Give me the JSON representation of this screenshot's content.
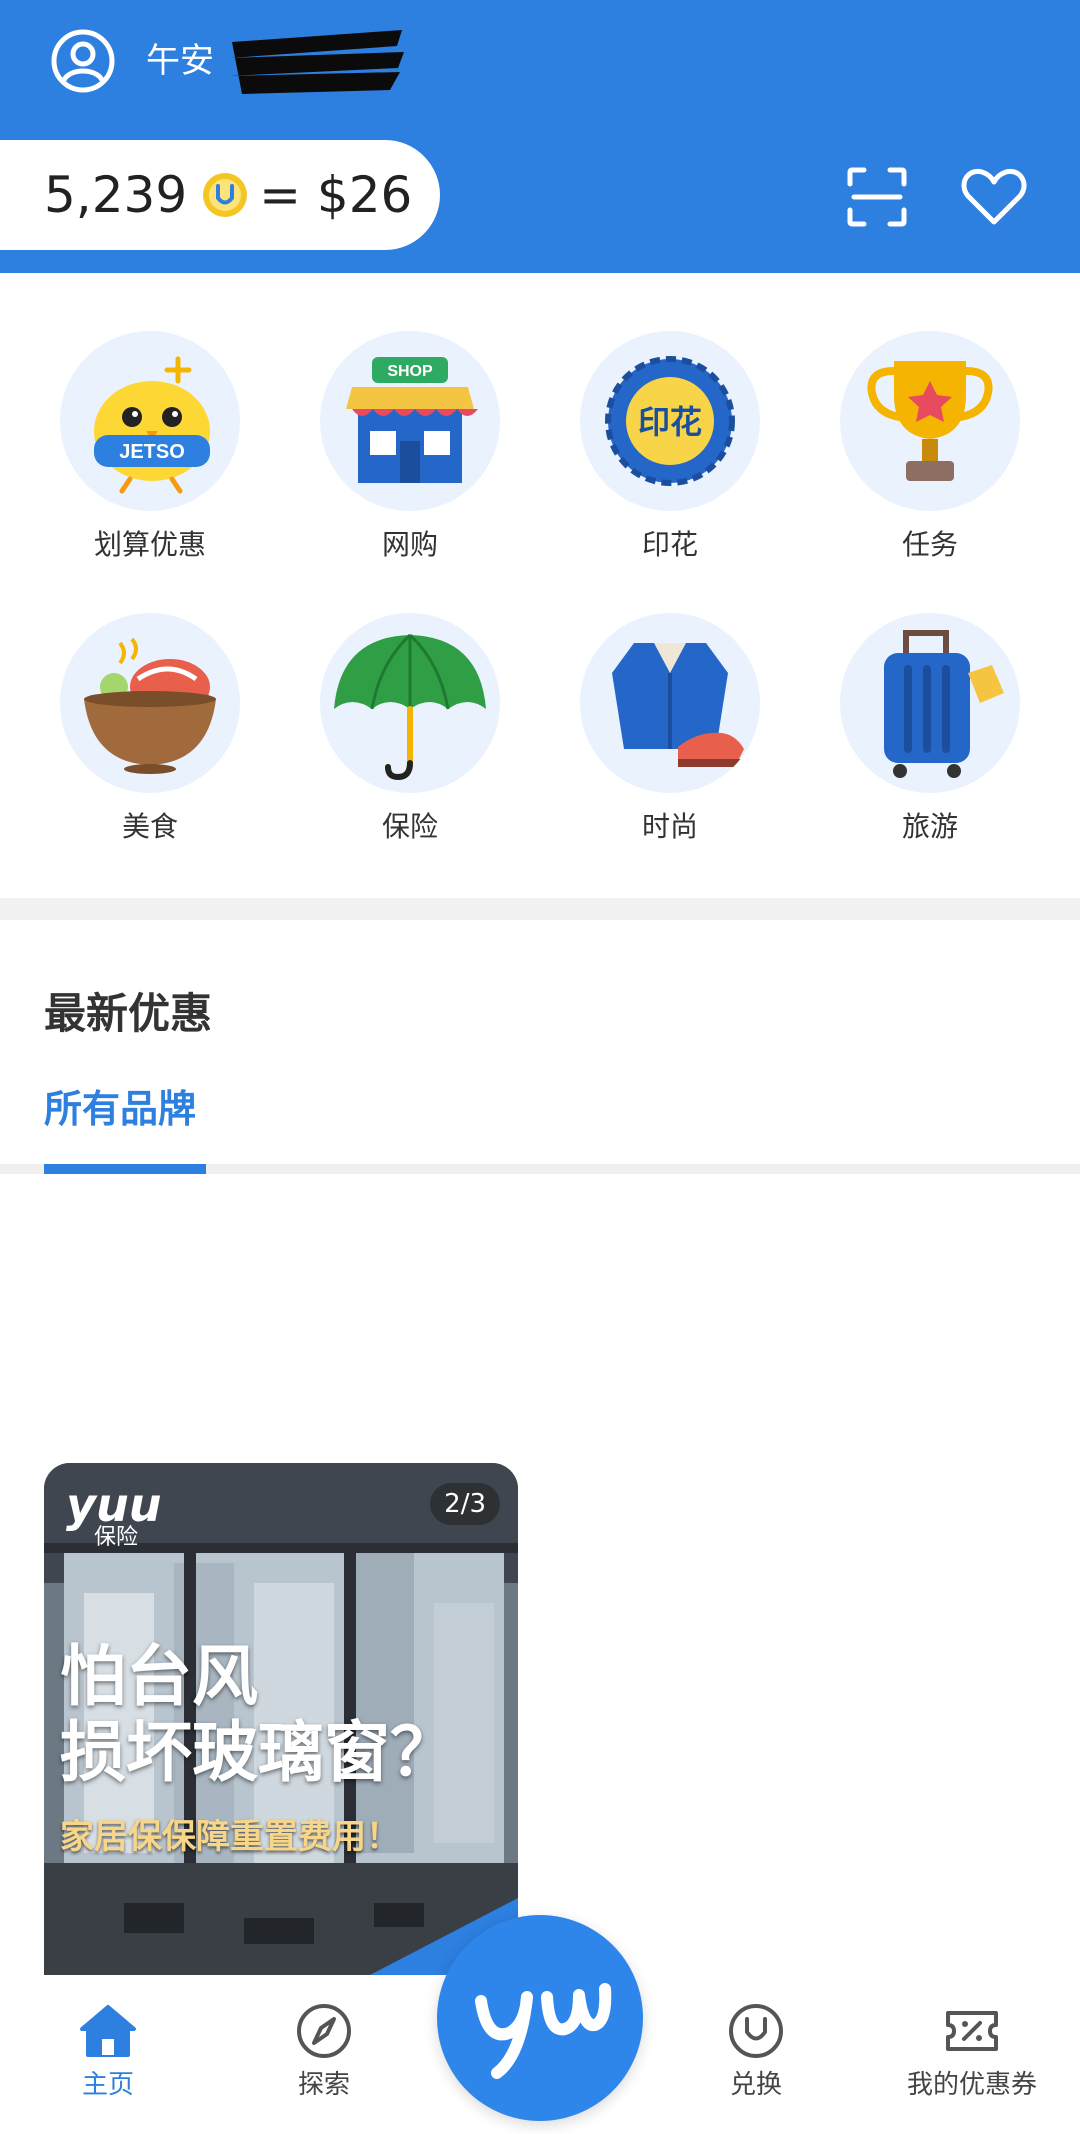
{
  "header": {
    "greeting": "午安",
    "points": "5,239",
    "equals": "= $26",
    "icons": {
      "avatar": "user-circle-icon",
      "coin": "yuu-coin-icon",
      "scan": "scan-icon",
      "favorite": "heart-icon"
    }
  },
  "categories": [
    {
      "label": "划算优惠",
      "icon": "jetso-chick-icon"
    },
    {
      "label": "网购",
      "icon": "shop-icon"
    },
    {
      "label": "印花",
      "icon": "stamp-icon"
    },
    {
      "label": "任务",
      "icon": "trophy-icon"
    },
    {
      "label": "美食",
      "icon": "food-bowl-icon"
    },
    {
      "label": "保险",
      "icon": "umbrella-icon"
    },
    {
      "label": "时尚",
      "icon": "fashion-icon"
    },
    {
      "label": "旅游",
      "icon": "luggage-icon"
    }
  ],
  "deals": {
    "title": "最新优惠",
    "tab": "所有品牌"
  },
  "promo": {
    "logo": "yuu",
    "logo_sub": "保险",
    "counter": "2/3",
    "headline": "怕台风\n损坏玻璃窗？",
    "subline": "家居保保障重置费用！"
  },
  "nav": {
    "items": [
      {
        "label": "主页",
        "icon": "home-icon"
      },
      {
        "label": "探索",
        "icon": "compass-icon"
      },
      {
        "label": "兑换",
        "icon": "yuu-redeem-icon"
      },
      {
        "label": "我的优惠券",
        "icon": "coupon-icon"
      }
    ],
    "center": "yuu"
  },
  "colors": {
    "brand": "#2d7fe0",
    "accent_text": "#f7d68a",
    "bubble": "#e9f2fd"
  }
}
